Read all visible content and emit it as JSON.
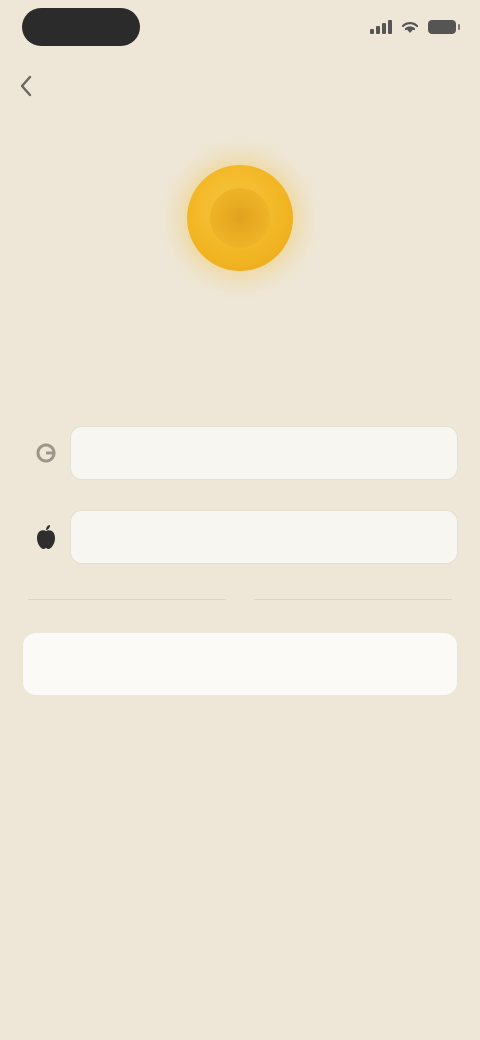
{
  "status_bar": {
    "time": "",
    "icons": [
      "signal-icon",
      "wifi-icon",
      "battery-icon"
    ]
  },
  "nav": {
    "back_icon": "chevron-left-icon",
    "title": ""
  },
  "hero": {
    "icon": "coin-icon",
    "accent_color": "#F2B624"
  },
  "description": "",
  "actions": [
    {
      "icon": "google-icon",
      "label": ""
    },
    {
      "icon": "apple-icon",
      "label": ""
    }
  ],
  "divider": {
    "text": ""
  },
  "email": {
    "placeholder": "",
    "value": ""
  },
  "colors": {
    "background": "#EEE7D7",
    "button": "#F8F6F1",
    "accent": "#F2B624"
  }
}
